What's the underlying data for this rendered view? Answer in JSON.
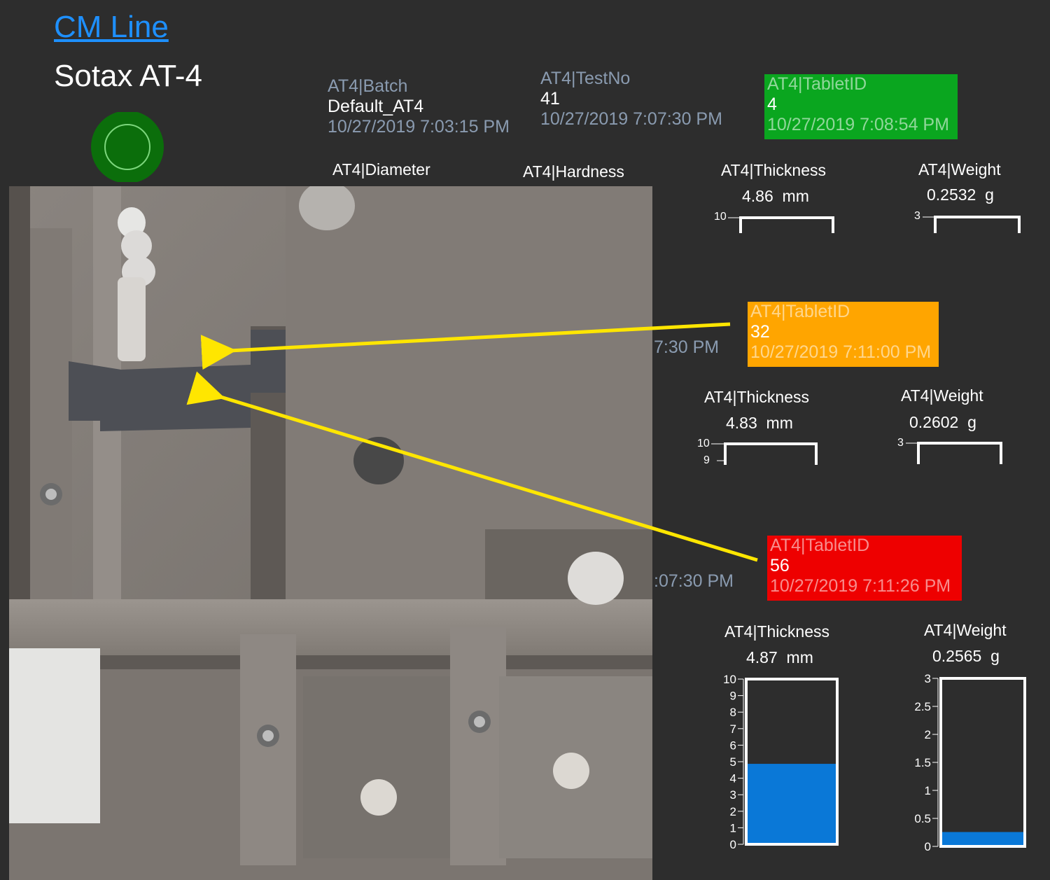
{
  "header": {
    "link": "CM Line",
    "title": "Sotax AT-4"
  },
  "status": {
    "indicator_color": "#0b6e0b"
  },
  "batch": {
    "label": "AT4|Batch",
    "value": "Default_AT4",
    "time": "10/27/2019 7:03:15 PM"
  },
  "testno": {
    "label": "AT4|TestNo",
    "value": "41",
    "time": "10/27/2019 7:07:30 PM"
  },
  "tablets": [
    {
      "label": "AT4|TabletID",
      "value": "4",
      "time": "10/27/2019 7:08:54 PM",
      "color": "#0aa61f"
    },
    {
      "label": "AT4|TabletID",
      "value": "32",
      "time": "10/27/2019 7:11:00 PM",
      "color": "#ffa500"
    },
    {
      "label": "AT4|TabletID",
      "value": "56",
      "time": "10/27/2019 7:11:26 PM",
      "color": "#ee0000"
    }
  ],
  "row1": {
    "diameter_label": "AT4|Diameter",
    "hardness_label": "AT4|Hardness",
    "thickness_label": "AT4|Thickness",
    "thickness_value": "4.86",
    "thickness_unit": "mm",
    "weight_label": "AT4|Weight",
    "weight_value": "0.2532",
    "weight_unit": "g"
  },
  "row2": {
    "partial_time": "7:30 PM",
    "thickness_label": "AT4|Thickness",
    "thickness_value": "4.83",
    "thickness_unit": "mm",
    "weight_label": "AT4|Weight",
    "weight_value": "0.2602",
    "weight_unit": "g"
  },
  "row3": {
    "partial_time": ":07:30 PM",
    "thickness_label": "AT4|Thickness",
    "thickness_value": "4.87",
    "thickness_unit": "mm",
    "weight_label": "AT4|Weight",
    "weight_value": "0.2565",
    "weight_unit": "g"
  },
  "ticks": {
    "row1_thickness": [
      "10"
    ],
    "row1_weight": [
      "3"
    ],
    "row2_thickness": [
      "10",
      "9"
    ],
    "row2_weight": [
      "3"
    ],
    "thickness_full": [
      "10",
      "9",
      "8",
      "7",
      "6",
      "5",
      "4",
      "3",
      "2",
      "1",
      "0"
    ],
    "weight_full": [
      "3",
      "2.5",
      "2",
      "1.5",
      "1",
      "0.5",
      "0"
    ]
  },
  "gauges": {
    "thickness": {
      "value": 4.87,
      "min": 0,
      "max": 10,
      "fill": "#0a78d7"
    },
    "weight": {
      "value": 0.2565,
      "min": 0,
      "max": 3,
      "fill": "#0a78d7"
    }
  },
  "annotation_color": "#ffe600"
}
